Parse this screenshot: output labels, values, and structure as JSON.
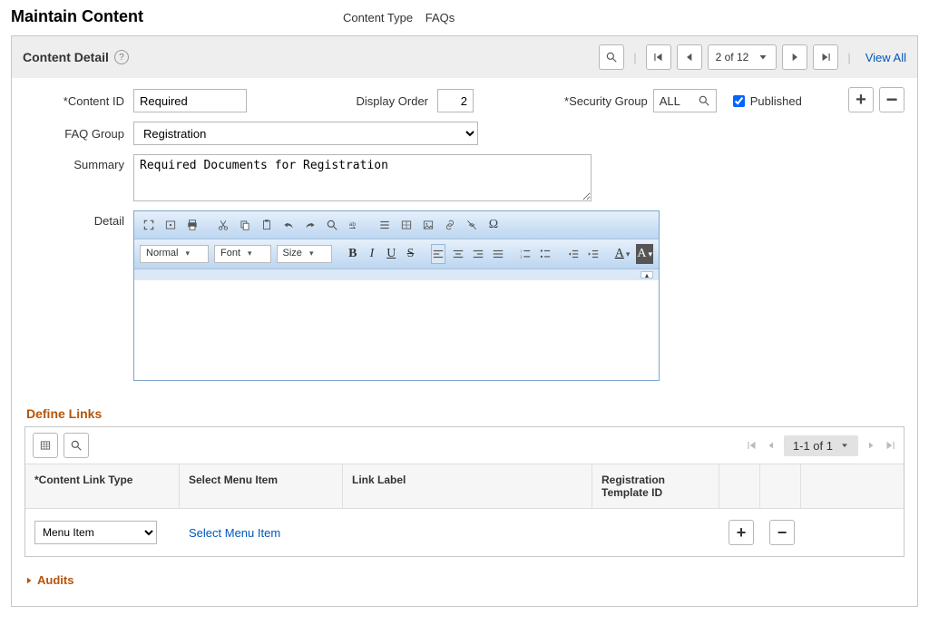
{
  "page_title": "Maintain Content",
  "header": {
    "content_type_label": "Content Type",
    "content_type_value": "FAQs"
  },
  "panel": {
    "title": "Content Detail",
    "nav": {
      "pager_text": "2 of 12",
      "view_all": "View All"
    }
  },
  "form": {
    "content_id": {
      "label": "Content ID",
      "value": "Required"
    },
    "display_order": {
      "label": "Display Order",
      "value": "2"
    },
    "security_group": {
      "label": "Security Group",
      "value": "ALL"
    },
    "published": {
      "label": "Published",
      "checked": true
    },
    "faq_group": {
      "label": "FAQ Group",
      "value": "Registration"
    },
    "summary": {
      "label": "Summary",
      "value": "Required Documents for Registration"
    },
    "detail": {
      "label": "Detail"
    }
  },
  "rte": {
    "ph_normal": "Normal",
    "ph_font": "Font",
    "ph_size": "Size",
    "bold": "B",
    "italic": "I",
    "underline": "U",
    "strike": "S",
    "acolor": "A"
  },
  "links": {
    "title": "Define Links",
    "pager": "1-1 of 1",
    "columns": {
      "c1": "*Content Link Type",
      "c2": "Select Menu Item",
      "c3": "Link Label",
      "c4": "Registration Template ID"
    },
    "row": {
      "type_value": "Menu Item",
      "select_link": "Select Menu Item"
    }
  },
  "audits": {
    "label": "Audits"
  }
}
